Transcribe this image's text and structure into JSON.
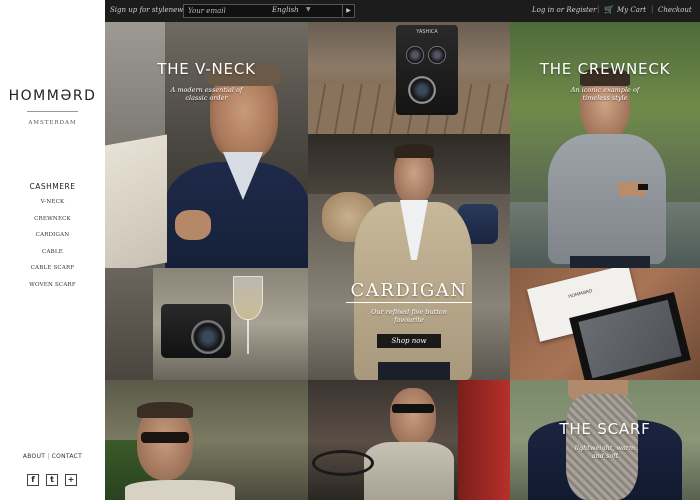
{
  "topbar": {
    "signup_label": "Sign up for stylenews",
    "email_placeholder": "Your email",
    "language": "English",
    "login": "Log in or Register",
    "cart": "My Cart",
    "checkout": "Checkout"
  },
  "sidebar": {
    "logo": "HOMMƏRD",
    "city": "AMSTERDAM",
    "heading": "CASHMERE",
    "items": [
      "V-NECK",
      "CREWNECK",
      "CARDIGAN",
      "CABLE",
      "CABLE SCARF",
      "WOVEN SCARF"
    ],
    "about": "ABOUT",
    "contact": "CONTACT",
    "social": [
      "f",
      "t",
      "+"
    ]
  },
  "tiles": {
    "vneck": {
      "title": "THE V-NECK",
      "subtitle_1": "A modern essential of",
      "subtitle_2": "classic order"
    },
    "crewneck": {
      "title": "THE CREWNECK",
      "subtitle_1": "An iconic example of",
      "subtitle_2": "timeless style"
    },
    "cardigan": {
      "title": "CARDIGAN",
      "subtitle_1": "Our refined five button",
      "subtitle_2": "favourite",
      "button": "Shop now"
    },
    "scarf": {
      "title": "THE SCARF",
      "subtitle_1": "lightweight, warm",
      "subtitle_2": "and soft"
    },
    "camera_label": "YASHICA",
    "box_label": "HOMMƏRD"
  }
}
